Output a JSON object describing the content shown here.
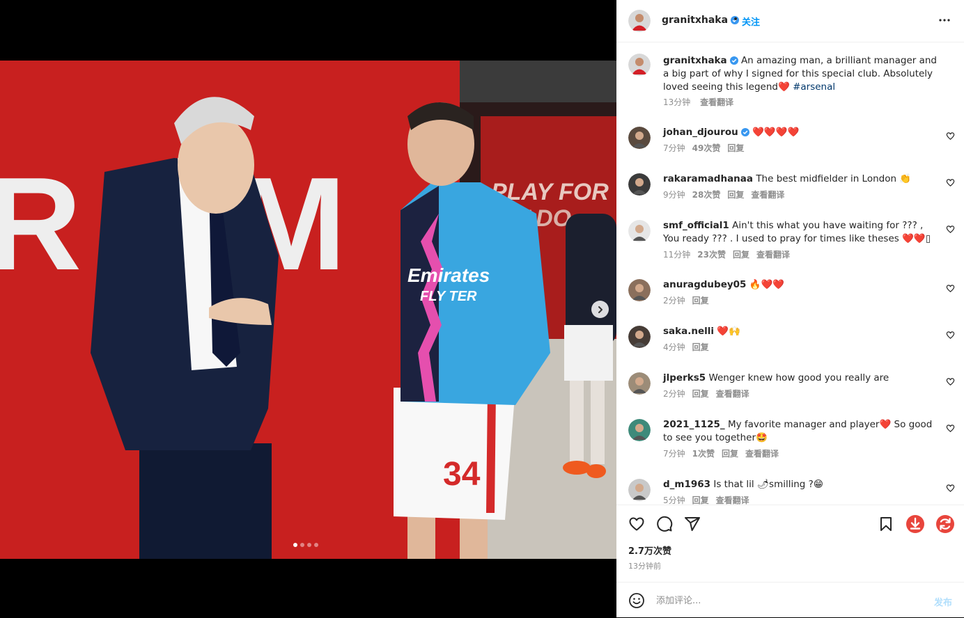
{
  "header": {
    "username": "granitxhaka",
    "dot": "•",
    "follow_label": "关注"
  },
  "caption": {
    "username": "granitxhaka",
    "text": "An amazing man, a brilliant manager and a big part of why I signed for this special club. Absolutely loved seeing this legend",
    "emoji": "❤️",
    "hashtag": "#arsenal",
    "time": "13分钟",
    "translate": "查看翻译"
  },
  "comments": [
    {
      "username": "johan_djourou",
      "verified": true,
      "text": "❤️❤️❤️❤️",
      "time": "7分钟",
      "likes": "49次赞",
      "reply": "回复",
      "translate": ""
    },
    {
      "username": "rakaramadhanaa",
      "verified": false,
      "text": "The best midfielder in London 👏",
      "time": "9分钟",
      "likes": "28次赞",
      "reply": "回复",
      "translate": "查看翻译"
    },
    {
      "username": "smf_official1",
      "verified": false,
      "text": "Ain't this what you have waiting for ??? , You ready ??? . I used to pray for times like theses ❤️❤️▯",
      "time": "11分钟",
      "likes": "23次赞",
      "reply": "回复",
      "translate": "查看翻译"
    },
    {
      "username": "anuragdubey05",
      "verified": false,
      "text": "🔥❤️❤️",
      "time": "2分钟",
      "likes": "",
      "reply": "回复",
      "translate": ""
    },
    {
      "username": "saka.nelli",
      "verified": false,
      "text": "❤️🙌",
      "time": "4分钟",
      "likes": "",
      "reply": "回复",
      "translate": ""
    },
    {
      "username": "jlperks5",
      "verified": false,
      "text": "Wenger knew how good you really are",
      "time": "2分钟",
      "likes": "",
      "reply": "回复",
      "translate": "查看翻译"
    },
    {
      "username": "2021_1125_",
      "verified": false,
      "text": "My favorite manager and player❤️ So good to see you together🤩",
      "time": "7分钟",
      "likes": "1次赞",
      "reply": "回复",
      "translate": "查看翻译"
    },
    {
      "username": "d_m1963",
      "verified": false,
      "text": "Is that lil 🌶smilling ?😁",
      "time": "5分钟",
      "likes": "",
      "reply": "回复",
      "translate": "查看翻译"
    }
  ],
  "footer": {
    "likes": "2.7万次赞",
    "time_ago": "13分钟前",
    "comment_placeholder": "添加评论...",
    "post_label": "发布"
  },
  "icons": {
    "like": "heart-icon",
    "comment": "comment-icon",
    "share": "send-icon",
    "save": "bookmark-icon",
    "download": "download-icon",
    "refresh": "refresh-icon",
    "more": "more-options-icon",
    "emoji": "emoji-icon",
    "next": "chevron-right-icon"
  },
  "colors": {
    "accent": "#0095f6",
    "verified": "#3897f0",
    "arsenal_red": "#c8201f",
    "extension_red": "#e8453c"
  },
  "carousel": {
    "total": 4,
    "active_index": 1
  }
}
